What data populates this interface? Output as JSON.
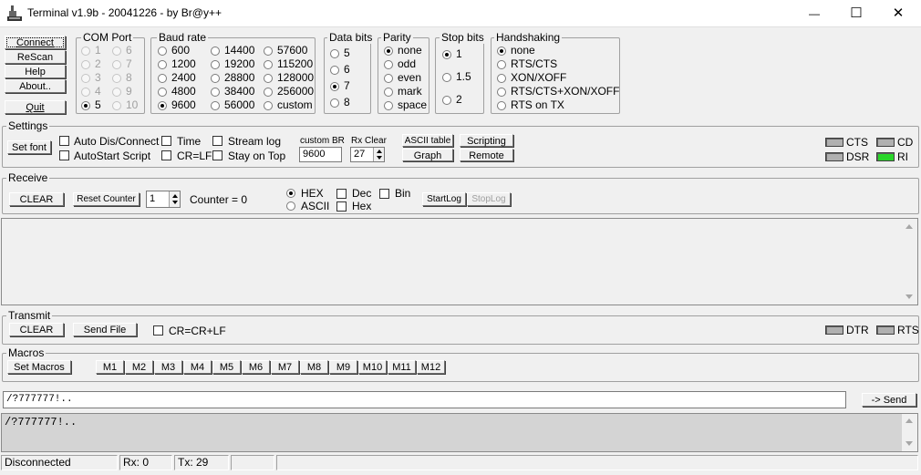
{
  "window": {
    "title": "Terminal v1.9b - 20041226 - by Br@y++",
    "minimize_glyph": "—",
    "maximize_glyph": "☐",
    "close_glyph": "✕"
  },
  "left_buttons": {
    "connect": "Connect",
    "rescan": "ReScan",
    "help": "Help",
    "about": "About..",
    "quit": "Quit"
  },
  "com_port": {
    "title": "COM Port",
    "options": [
      "1",
      "2",
      "3",
      "4",
      "5",
      "6",
      "7",
      "8",
      "9",
      "10"
    ],
    "selected": "5"
  },
  "baud_rate": {
    "title": "Baud rate",
    "options": [
      "600",
      "1200",
      "2400",
      "4800",
      "9600",
      "14400",
      "19200",
      "28800",
      "38400",
      "56000",
      "57600",
      "115200",
      "128000",
      "256000",
      "custom"
    ],
    "selected": "9600"
  },
  "data_bits": {
    "title": "Data bits",
    "options": [
      "5",
      "6",
      "7",
      "8"
    ],
    "selected": "7"
  },
  "parity": {
    "title": "Parity",
    "options": [
      "none",
      "odd",
      "even",
      "mark",
      "space"
    ],
    "selected": "none"
  },
  "stop_bits": {
    "title": "Stop bits",
    "options": [
      "1",
      "1.5",
      "2"
    ],
    "selected": "1"
  },
  "handshaking": {
    "title": "Handshaking",
    "options": [
      "none",
      "RTS/CTS",
      "XON/XOFF",
      "RTS/CTS+XON/XOFF",
      "RTS on TX"
    ],
    "selected": "none"
  },
  "settings": {
    "title": "Settings",
    "set_font": "Set font",
    "auto_dis_connect": "Auto Dis/Connect",
    "autostart_script": "AutoStart Script",
    "time": "Time",
    "cr_lf": "CR=LF",
    "stream_log": "Stream log",
    "stay_on_top": "Stay on Top",
    "custom_br_label": "custom BR",
    "custom_br_value": "9600",
    "rx_clear_label": "Rx Clear",
    "rx_clear_value": "27",
    "ascii_table": "ASCII table",
    "scripting": "Scripting",
    "graph": "Graph",
    "remote": "Remote",
    "leds": {
      "cts": "CTS",
      "cd": "CD",
      "dsr": "DSR",
      "ri": "RI"
    },
    "led_colors": {
      "off": "#b0b0b0",
      "on": "#29d629"
    }
  },
  "receive": {
    "title": "Receive",
    "clear": "CLEAR",
    "reset_counter": "Reset Counter",
    "counter_spin_value": "1",
    "counter_label": "Counter = ",
    "counter_value": "0",
    "hex": "HEX",
    "ascii": "ASCII",
    "format_selected": "HEX",
    "dec": "Dec",
    "hex_chk": "Hex",
    "bin": "Bin",
    "startlog": "StartLog",
    "stoplog": "StopLog",
    "content": ""
  },
  "transmit": {
    "title": "Transmit",
    "clear": "CLEAR",
    "send_file": "Send File",
    "cr_crlf": "CR=CR+LF",
    "dtr": "DTR",
    "rts": "RTS"
  },
  "macros": {
    "title": "Macros",
    "set_macros": "Set Macros",
    "buttons": [
      "M1",
      "M2",
      "M3",
      "M4",
      "M5",
      "M6",
      "M7",
      "M8",
      "M9",
      "M10",
      "M11",
      "M12"
    ]
  },
  "send": {
    "input_value": "/?777777!..",
    "button": "-> Send"
  },
  "transmit_log": {
    "content": "/?777777!.."
  },
  "statusbar": {
    "status": "Disconnected",
    "rx": "Rx: 0",
    "tx": "Tx: 29"
  }
}
